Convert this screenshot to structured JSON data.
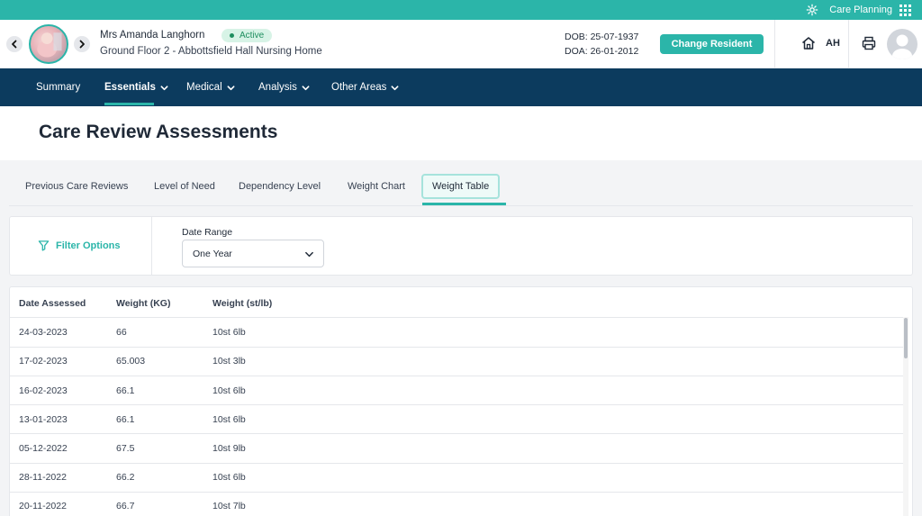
{
  "topbar": {
    "app_label": "Care Planning",
    "icons": [
      "gear-icon",
      "apps-grid-icon"
    ]
  },
  "resident": {
    "name": "Mrs Amanda Langhorn",
    "status": "Active",
    "location": "Ground Floor 2 - Abbottsfield Hall Nursing Home",
    "dob": "DOB: 25-07-1937",
    "doa": "DOA: 26-01-2012",
    "change_button": "Change Resident"
  },
  "user": {
    "initials": "AH"
  },
  "nav": [
    {
      "label": "Summary",
      "dropdown": false
    },
    {
      "label": "Essentials",
      "dropdown": true,
      "active": true
    },
    {
      "label": "Medical",
      "dropdown": true
    },
    {
      "label": "Analysis",
      "dropdown": true
    },
    {
      "label": "Other Areas",
      "dropdown": true
    }
  ],
  "page": {
    "title": "Care Review Assessments"
  },
  "tabs": [
    {
      "label": "Previous Care Reviews"
    },
    {
      "label": "Level of Need"
    },
    {
      "label": "Dependency Level"
    },
    {
      "label": "Weight Chart"
    },
    {
      "label": "Weight Table",
      "active": true
    }
  ],
  "filter": {
    "label": "Filter Options",
    "date_range_label": "Date Range",
    "date_range_value": "One Year"
  },
  "table": {
    "headers": [
      "Date Assessed",
      "Weight (KG)",
      "Weight (st/lb)"
    ],
    "rows": [
      [
        "24-03-2023",
        "66",
        "10st 6lb"
      ],
      [
        "17-02-2023",
        "65.003",
        "10st 3lb"
      ],
      [
        "16-02-2023",
        "66.1",
        "10st 6lb"
      ],
      [
        "13-01-2023",
        "66.1",
        "10st 6lb"
      ],
      [
        "05-12-2022",
        "67.5",
        "10st 9lb"
      ],
      [
        "28-11-2022",
        "66.2",
        "10st 6lb"
      ],
      [
        "20-11-2022",
        "66.7",
        "10st 7lb"
      ]
    ]
  },
  "colors": {
    "accent": "#2bb5a9",
    "nav_bg": "#0c3b5e",
    "status_bg": "#d7f3e6",
    "status_text": "#1e8e5f"
  }
}
